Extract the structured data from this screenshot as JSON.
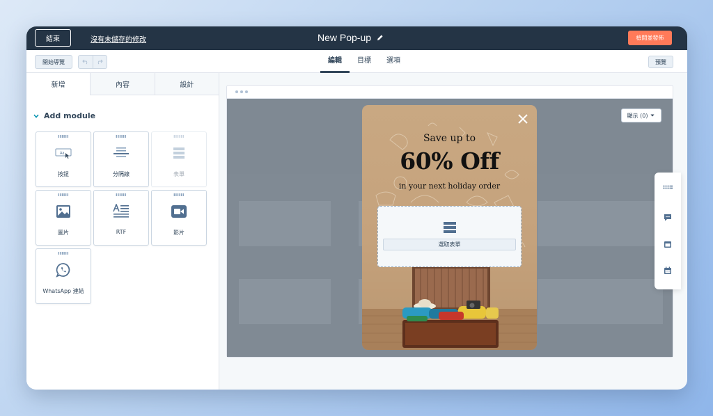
{
  "topbar": {
    "exit_label": "結束",
    "unsaved_label": "沒有未儲存的修改",
    "title": "New Pop-up",
    "publish_label": "檢閱並發佈"
  },
  "toolbar": {
    "tour_label": "開始導覽",
    "tabs": [
      {
        "label": "編輯",
        "active": true
      },
      {
        "label": "目標",
        "active": false
      },
      {
        "label": "選項",
        "active": false
      }
    ],
    "preview_label": "預覽"
  },
  "sidebar": {
    "tabs": [
      {
        "label": "新增",
        "active": true
      },
      {
        "label": "內容",
        "active": false
      },
      {
        "label": "設計",
        "active": false
      }
    ],
    "section_title": "Add module",
    "modules": [
      {
        "label": "按鈕",
        "icon": "button-icon",
        "disabled": false
      },
      {
        "label": "分隔線",
        "icon": "divider-icon",
        "disabled": false
      },
      {
        "label": "表單",
        "icon": "form-icon",
        "disabled": true
      },
      {
        "label": "圖片",
        "icon": "image-icon",
        "disabled": false
      },
      {
        "label": "RTF",
        "icon": "rich-text-icon",
        "disabled": false
      },
      {
        "label": "影片",
        "icon": "video-icon",
        "disabled": false
      },
      {
        "label": "WhatsApp 連結",
        "icon": "whatsapp-icon",
        "disabled": false
      }
    ]
  },
  "canvas": {
    "show_label": "顯示 (0)",
    "popup": {
      "line1": "Save up to",
      "line2": "60% Off",
      "line3": "in your next holiday order",
      "form_button_label": "選取表單"
    }
  },
  "colors": {
    "topbar_bg": "#243445",
    "accent": "#ff7a59",
    "text": "#33475b"
  }
}
